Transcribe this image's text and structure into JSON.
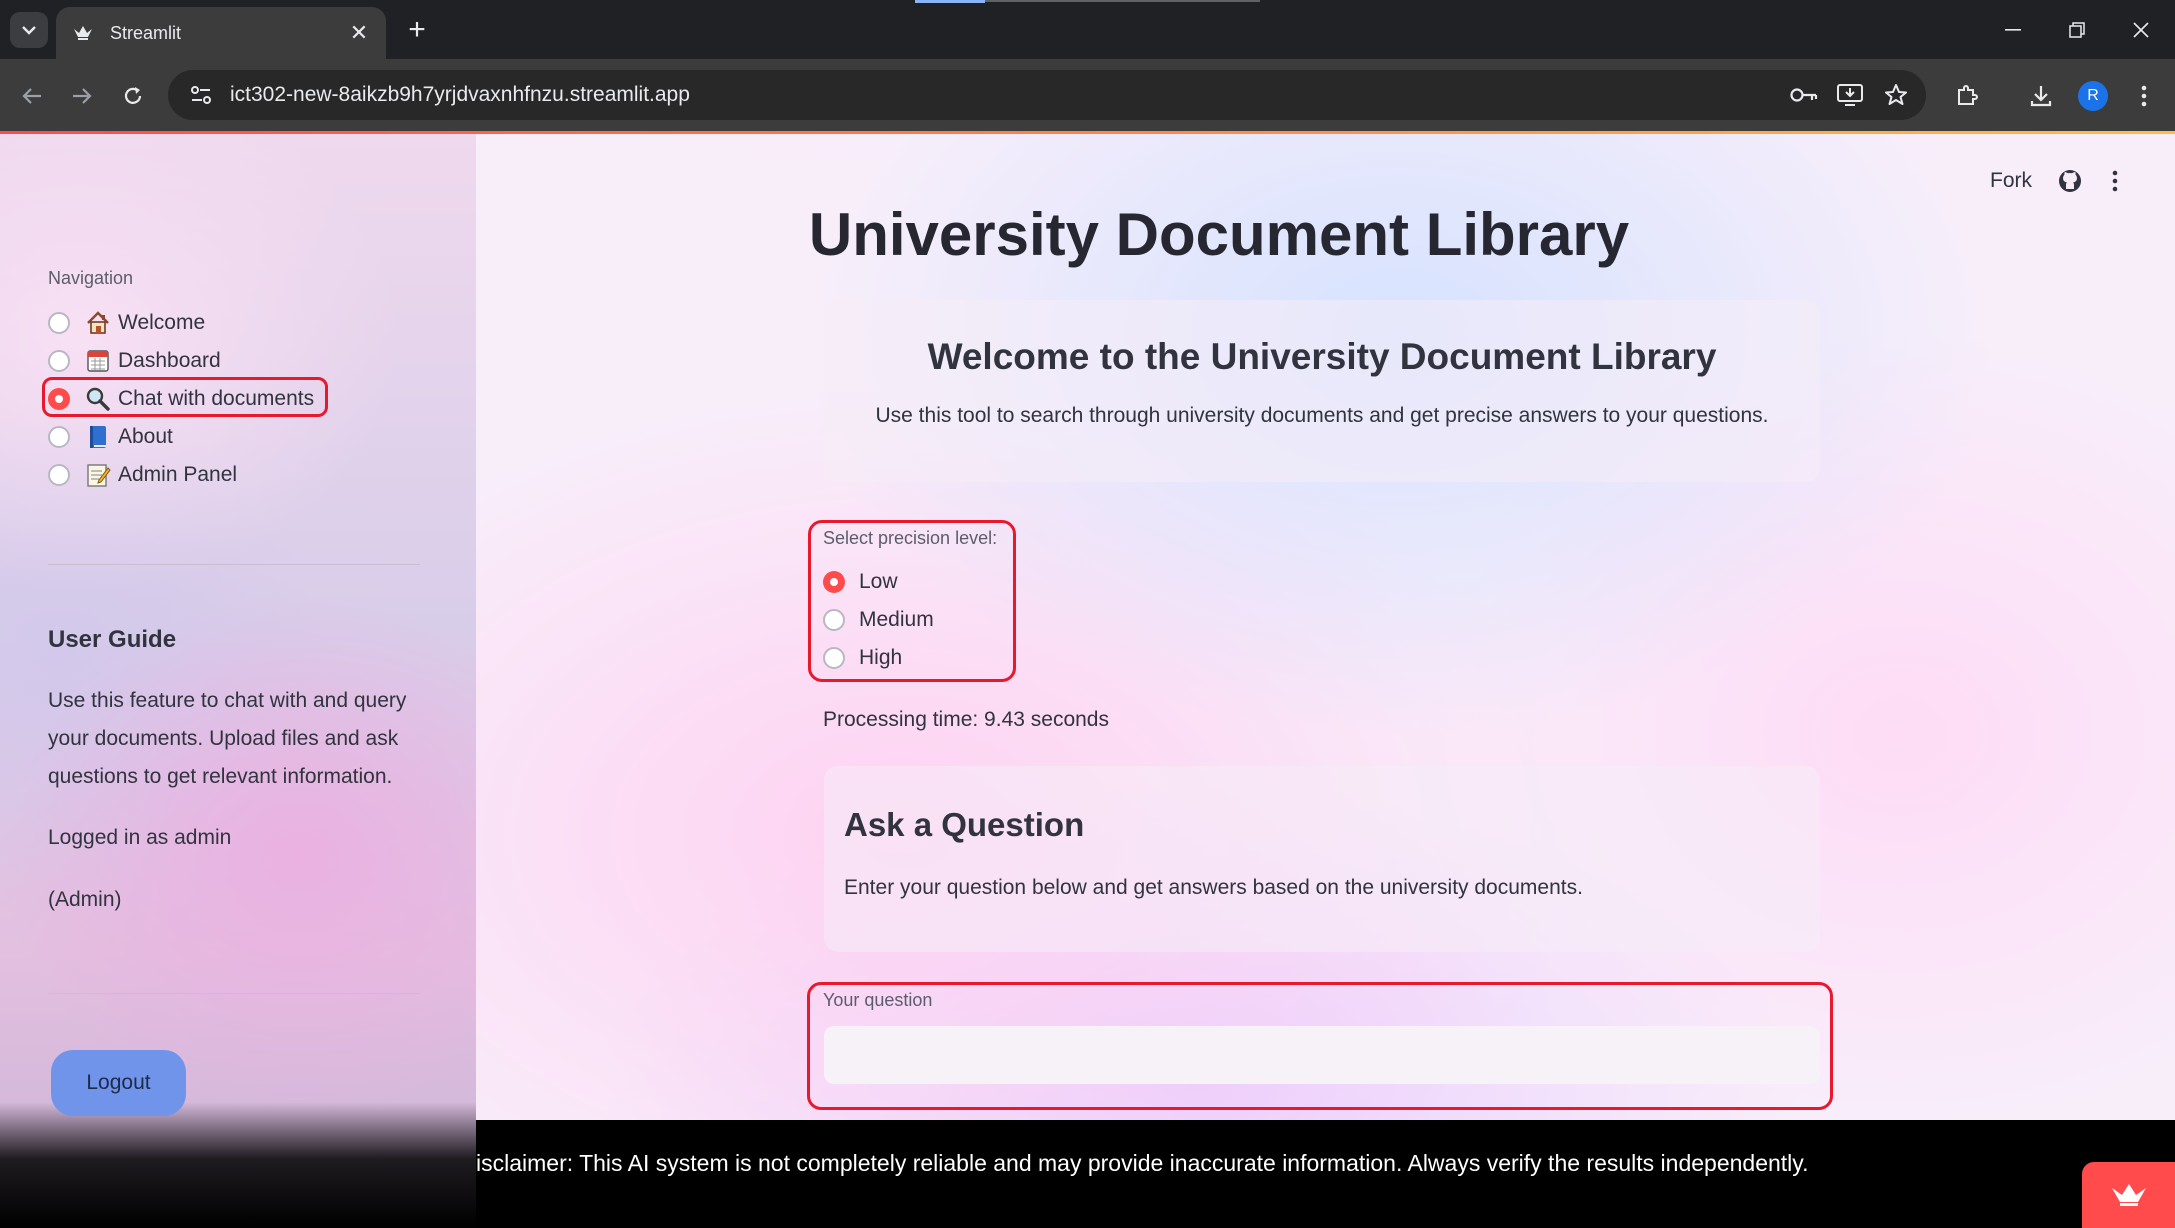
{
  "browser": {
    "tab_title": "Streamlit",
    "url": "ict302-new-8aikzb9h7yrjdvaxnhfnzu.streamlit.app",
    "avatar_initial": "R",
    "new_tab_symbol": "+",
    "close_symbol": "✕"
  },
  "sidebar": {
    "nav_caption": "Navigation",
    "nav_items": [
      {
        "label": "Welcome",
        "icon": "house-icon",
        "selected": false
      },
      {
        "label": "Dashboard",
        "icon": "calendar-icon",
        "selected": false
      },
      {
        "label": "Chat with documents",
        "icon": "magnifier-icon",
        "selected": true
      },
      {
        "label": "About",
        "icon": "book-icon",
        "selected": false
      },
      {
        "label": "Admin Panel",
        "icon": "memo-icon",
        "selected": false
      }
    ],
    "guide_title": "User Guide",
    "guide_text": "Use this feature to chat with and query your documents. Upload files and ask questions to get relevant information.",
    "logged_in": "Logged in as admin",
    "role": "(Admin)",
    "logout_label": "Logout"
  },
  "header": {
    "fork_label": "Fork"
  },
  "main": {
    "title": "University Document Library",
    "welcome_title": "Welcome to the University Document Library",
    "welcome_text": "Use this tool to search through university documents and get precise answers to your questions.",
    "precision_caption": "Select precision level:",
    "precision_options": [
      {
        "label": "Low",
        "selected": true
      },
      {
        "label": "Medium",
        "selected": false
      },
      {
        "label": "High",
        "selected": false
      }
    ],
    "processing_time": "Processing time: 9.43 seconds",
    "ask_title": "Ask a Question",
    "ask_text": "Enter your question below and get answers based on the university documents.",
    "question_label": "Your question",
    "question_value": "",
    "question_placeholder": ""
  },
  "footer": {
    "disclaimer": "isclaimer: This AI system is not completely reliable and may provide inaccurate information. Always verify the results independently."
  },
  "colors": {
    "accent": "#ff4b4b",
    "highlight": "#e8192c",
    "logout": "#6f94ea"
  }
}
